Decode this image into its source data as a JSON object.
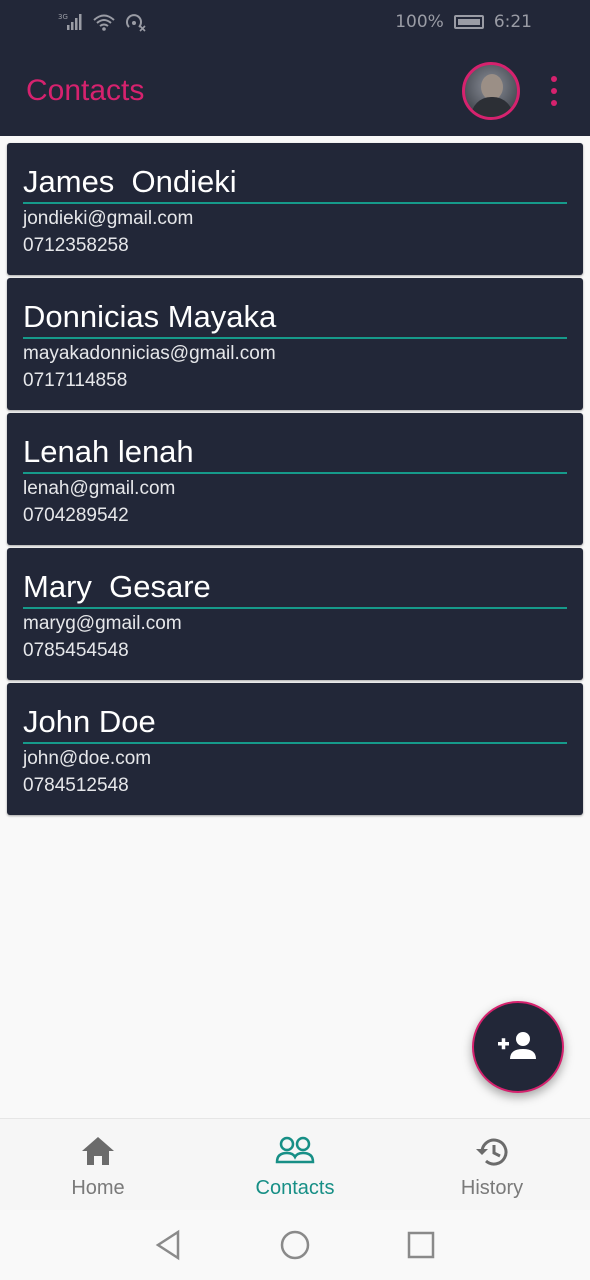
{
  "status_bar": {
    "network": "3G",
    "battery": "100%",
    "time": "6:21"
  },
  "app_bar": {
    "title": "Contacts",
    "avatar_icon": "user-avatar",
    "menu_icon": "more-vertical-icon"
  },
  "contacts": [
    {
      "name": "James  Ondieki",
      "email": "jondieki@gmail.com",
      "phone": "0712358258"
    },
    {
      "name": "Donnicias Mayaka",
      "email": "mayakadonnicias@gmail.com",
      "phone": "0717114858"
    },
    {
      "name": "Lenah lenah",
      "email": "lenah@gmail.com",
      "phone": "0704289542"
    },
    {
      "name": "Mary  Gesare",
      "email": "maryg@gmail.com",
      "phone": "0785454548"
    },
    {
      "name": "John Doe",
      "email": "john@doe.com",
      "phone": "0784512548"
    }
  ],
  "fab": {
    "icon": "add-person-icon"
  },
  "bottom_nav": {
    "items": [
      {
        "label": "Home",
        "icon": "home-icon",
        "active": false
      },
      {
        "label": "Contacts",
        "icon": "people-icon",
        "active": true
      },
      {
        "label": "History",
        "icon": "history-icon",
        "active": false
      }
    ]
  },
  "colors": {
    "bar_bg": "#222738",
    "accent_pink": "#d6226e",
    "accent_teal": "#178f86"
  }
}
